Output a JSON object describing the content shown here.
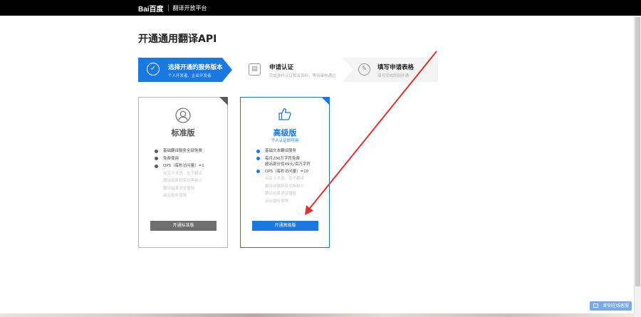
{
  "header": {
    "brand_logo": "Bai百度",
    "brand_title": "翻译开放平台"
  },
  "page": {
    "title": "开通通用翻译API"
  },
  "steps": [
    {
      "title": "选择开通的服务版本",
      "desc": "个人开发者、企业开发者",
      "state": "active"
    },
    {
      "title": "申请认证",
      "desc": "完成身份认证相关资料，等待审核通过",
      "state": "pending"
    },
    {
      "title": "填写申请表格",
      "desc": "填写完成即刻开通",
      "state": "pending"
    }
  ],
  "plans": {
    "standard": {
      "name": "标准版",
      "features": [
        {
          "text": "基础翻译服务全部免费",
          "enabled": true
        },
        {
          "text": "免费使用",
          "enabled": true
        },
        {
          "text": "QPS（每秒访问量）=1",
          "enabled": true
        },
        {
          "text": "自定义术语、位子翻译",
          "enabled": false
        },
        {
          "text": "翻译结果附带词典释义",
          "enabled": false
        },
        {
          "text": "翻译结果语音播报",
          "enabled": false
        },
        {
          "text": "商业服务保障",
          "enabled": false
        }
      ],
      "button_label": "开通标准版"
    },
    "advanced": {
      "name": "高级版",
      "subtitle": "个人认证即可用",
      "features": [
        {
          "text": "基础文本翻译服务",
          "enabled": true
        },
        {
          "text": "每月200万字符免费",
          "enabled": true
        },
        {
          "text": "超出部分仅49元/百万字符",
          "enabled": true,
          "continuation": true
        },
        {
          "text": "QPS（每秒访问量）=10",
          "enabled": true
        },
        {
          "text": "自定义术语、位子翻译",
          "enabled": false
        },
        {
          "text": "翻译结果附带词典释义",
          "enabled": false
        },
        {
          "text": "翻译结果语音播报",
          "enabled": false
        },
        {
          "text": "商业服务保障",
          "enabled": false
        }
      ],
      "button_label": "开通高级版"
    }
  },
  "feedback": {
    "label": "即刻在线客服"
  },
  "colors": {
    "accent": "#1b78e0",
    "annotation_arrow": "#e03030",
    "topbar": "#000000"
  }
}
